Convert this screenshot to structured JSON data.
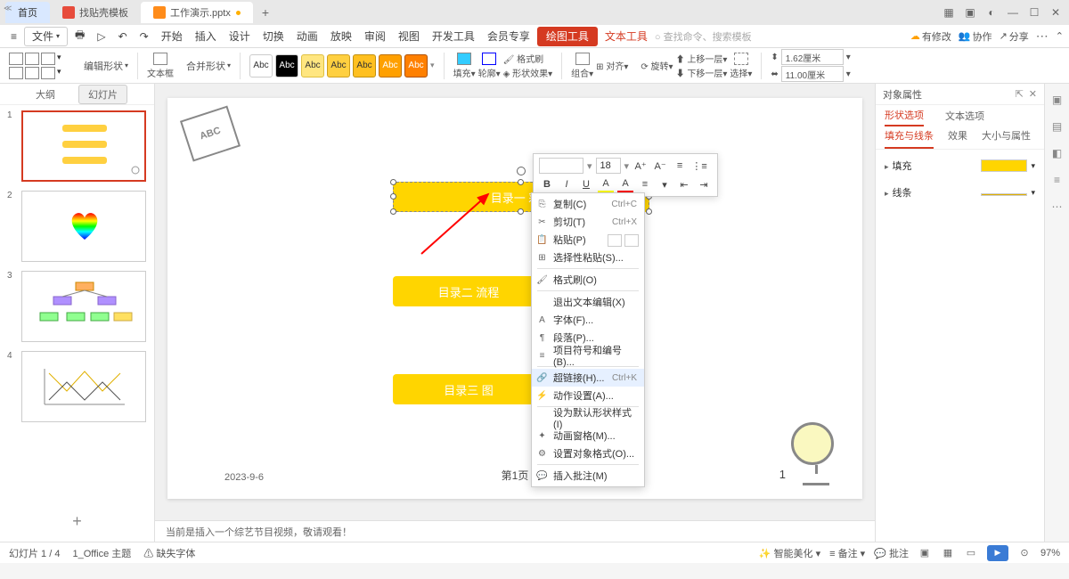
{
  "tabs": {
    "home": "首页",
    "file1": "找贴壳模板",
    "file2": "工作演示.pptx"
  },
  "menu": {
    "file": "文件",
    "start": "开始",
    "insert": "插入",
    "design": "设计",
    "transition": "切换",
    "animation": "动画",
    "slideshow": "放映",
    "review": "审阅",
    "view": "视图",
    "devtools": "开发工具",
    "member": "会员专享",
    "drawtool": "绘图工具",
    "texttool": "文本工具",
    "search": "○ 查找命令、搜索模板",
    "changes": "有修改",
    "collab": "协作",
    "share": "分享"
  },
  "ribbon": {
    "edit_shape": "编辑形状",
    "merge_shape": "合并形状",
    "textbox": "文本框",
    "abc": "Abc",
    "fill": "填充",
    "outline": "轮廓",
    "shape_effect": "形状效果",
    "format_painter": "格式刷",
    "group": "组合",
    "align": "对齐",
    "rotate": "旋转",
    "bring_fwd": "上移一层",
    "send_back": "下移一层",
    "select": "选择",
    "height": "1.62厘米",
    "width": "11.00厘米"
  },
  "left": {
    "outline": "大纲",
    "slides": "幻灯片"
  },
  "slide": {
    "abc": "ABC",
    "cat1": "目录一  彩虹",
    "cat2": "目录二   流程",
    "cat3": "目录三   图",
    "date": "2023-9-6",
    "page": "第1页",
    "num": "1"
  },
  "mini": {
    "fontsize": "18"
  },
  "ctx": {
    "copy": "复制(C)",
    "copy_sc": "Ctrl+C",
    "cut": "剪切(T)",
    "cut_sc": "Ctrl+X",
    "paste": "粘贴(P)",
    "paste_special": "选择性粘贴(S)...",
    "format_painter": "格式刷(O)",
    "exit_text": "退出文本编辑(X)",
    "font": "字体(F)...",
    "paragraph": "段落(P)...",
    "bullets": "项目符号和编号(B)...",
    "hyperlink": "超链接(H)...",
    "hyperlink_sc": "Ctrl+K",
    "action": "动作设置(A)...",
    "set_default": "设为默认形状样式(I)",
    "anim_pane": "动画窗格(M)...",
    "obj_format": "设置对象格式(O)...",
    "insert_comment": "插入批注(M)"
  },
  "right_panel": {
    "title": "对象属性",
    "tab_shape": "形状选项",
    "tab_text": "文本选项",
    "sub_fill": "填充与线条",
    "sub_effect": "效果",
    "sub_size": "大小与属性",
    "fill": "填充",
    "line": "线条"
  },
  "notes": "当前是插入一个综艺节目视频，敬请观看！",
  "status": {
    "slide_count": "幻灯片 1 / 4",
    "theme": "1_Office 主题",
    "missing_font": "缺失字体",
    "beautify": "智能美化",
    "notes": "备注",
    "comments": "批注",
    "zoom": "97%"
  }
}
